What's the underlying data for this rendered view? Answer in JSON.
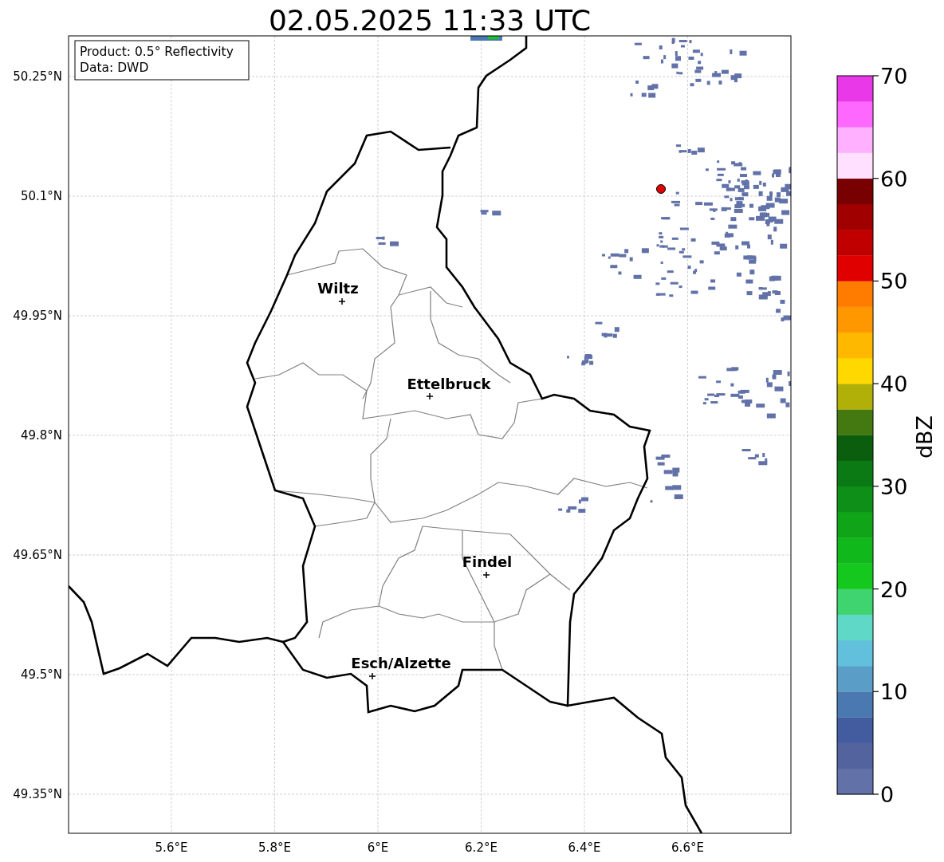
{
  "title": "02.05.2025 11:33 UTC",
  "info_box": {
    "lines": [
      "Product: 0.5° Reflectivity",
      "Data: DWD"
    ]
  },
  "map": {
    "lat_ticks": [
      "50.25°N",
      "50.1°N",
      "49.95°N",
      "49.8°N",
      "49.65°N",
      "49.5°N",
      "49.35°N"
    ],
    "lon_ticks": [
      "5.6°E",
      "5.8°E",
      "6°E",
      "6.2°E",
      "6.4°E",
      "6.6°E"
    ],
    "places": [
      {
        "name": "Wiltz"
      },
      {
        "name": "Ettelbruck"
      },
      {
        "name": "Findel"
      },
      {
        "name": "Esch/Alzette"
      }
    ]
  },
  "colorbar": {
    "label": "dBZ",
    "ticks": [
      "70",
      "60",
      "50",
      "40",
      "30",
      "20",
      "10",
      "0"
    ],
    "segments": [
      {
        "color": "#6272a8"
      },
      {
        "color": "#52639e"
      },
      {
        "color": "#435ca0"
      },
      {
        "color": "#4a78b0"
      },
      {
        "color": "#5a9ec8"
      },
      {
        "color": "#62c0dc"
      },
      {
        "color": "#60d8c8"
      },
      {
        "color": "#40d470"
      },
      {
        "color": "#14c81e"
      },
      {
        "color": "#10b81c"
      },
      {
        "color": "#10a418"
      },
      {
        "color": "#0e9018"
      },
      {
        "color": "#0c7a14"
      },
      {
        "color": "#0a5e0e"
      },
      {
        "color": "#447810"
      },
      {
        "color": "#b0b008"
      },
      {
        "color": "#ffd800"
      },
      {
        "color": "#ffb800"
      },
      {
        "color": "#ff9800"
      },
      {
        "color": "#ff7c00"
      },
      {
        "color": "#e00000"
      },
      {
        "color": "#c00000"
      },
      {
        "color": "#a00000"
      },
      {
        "color": "#780000"
      },
      {
        "color": "#ffe0ff"
      },
      {
        "color": "#ffb0ff"
      },
      {
        "color": "#ff68ff"
      },
      {
        "color": "#e838e8"
      }
    ]
  }
}
